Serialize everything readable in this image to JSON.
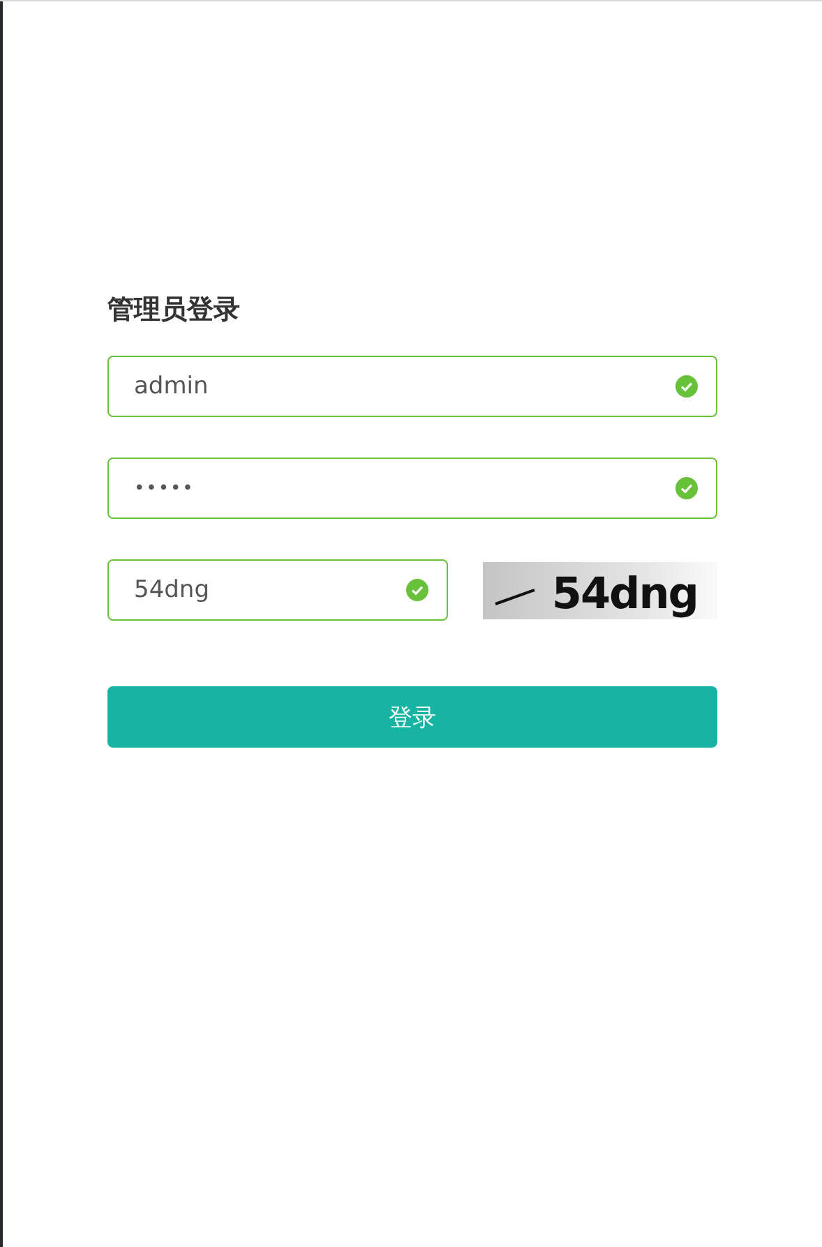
{
  "title": "管理员登录",
  "fields": [
    {
      "kind": "text",
      "value": "admin",
      "valid": true
    },
    {
      "kind": "password",
      "value": "•••••",
      "valid": true
    },
    {
      "kind": "captcha",
      "value": "54dng",
      "valid": true
    }
  ],
  "captcha_image": {
    "text": "54dng"
  },
  "submit_button": "登录"
}
